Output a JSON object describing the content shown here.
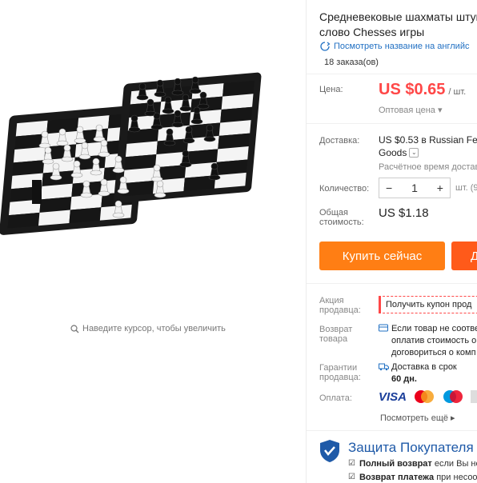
{
  "product": {
    "title_line1": "Средневековые шахматы штук",
    "title_line2": "слово Chesses игры",
    "translate_link": "Посмотреть название на английс",
    "orders": "18 заказа(ов)"
  },
  "price": {
    "label": "Цена:",
    "value": "US $0.65",
    "unit": "/ шт.",
    "wholesale": "Оптовая цена ▾"
  },
  "shipping": {
    "label": "Доставка:",
    "value_prefix": "US $0.53",
    "value_in": " в ",
    "carrier": "Russian Fede",
    "carrier_line2": "Goods",
    "estimate": "Расчётное время достав"
  },
  "quantity": {
    "label": "Количество:",
    "minus": "−",
    "value": "1",
    "plus": "+",
    "unit": "шт. (9"
  },
  "total": {
    "label_line1": "Общая",
    "label_line2": "стоимость:",
    "value": "US $1.18"
  },
  "buttons": {
    "buy_now": "Купить сейчас",
    "add_cart": "Д"
  },
  "seller_promo": {
    "label_line1": "Акция",
    "label_line2": "продавца:",
    "coupon": "Получить купон прод"
  },
  "returns": {
    "label_line1": "Возврат",
    "label_line2": "товара",
    "line1": "Если товар не соотве",
    "line2": "оплатив стоимость о",
    "line3": "договориться о комп"
  },
  "guarantee": {
    "label_line1": "Гарантии",
    "label_line2": "продавца:",
    "line1": "Доставка в срок",
    "line2": "60 дн."
  },
  "payment": {
    "label": "Оплата:",
    "visa": "VISA",
    "more": "Посмотреть ещё ▸"
  },
  "protection": {
    "title": "Защита Покупателя",
    "line1_bold": "Полный возврат",
    "line1_rest": " если Вы не",
    "line2_bold": "Возврат платежа",
    "line2_rest": " при несоот"
  },
  "gallery": {
    "zoom_hint": "Наведите курсор, чтобы увеличить"
  },
  "colors": {
    "price_red": "#ff4747",
    "buy_orange": "#ff7e14",
    "link_blue": "#2170c3",
    "protect_blue": "#1f5aa8"
  }
}
